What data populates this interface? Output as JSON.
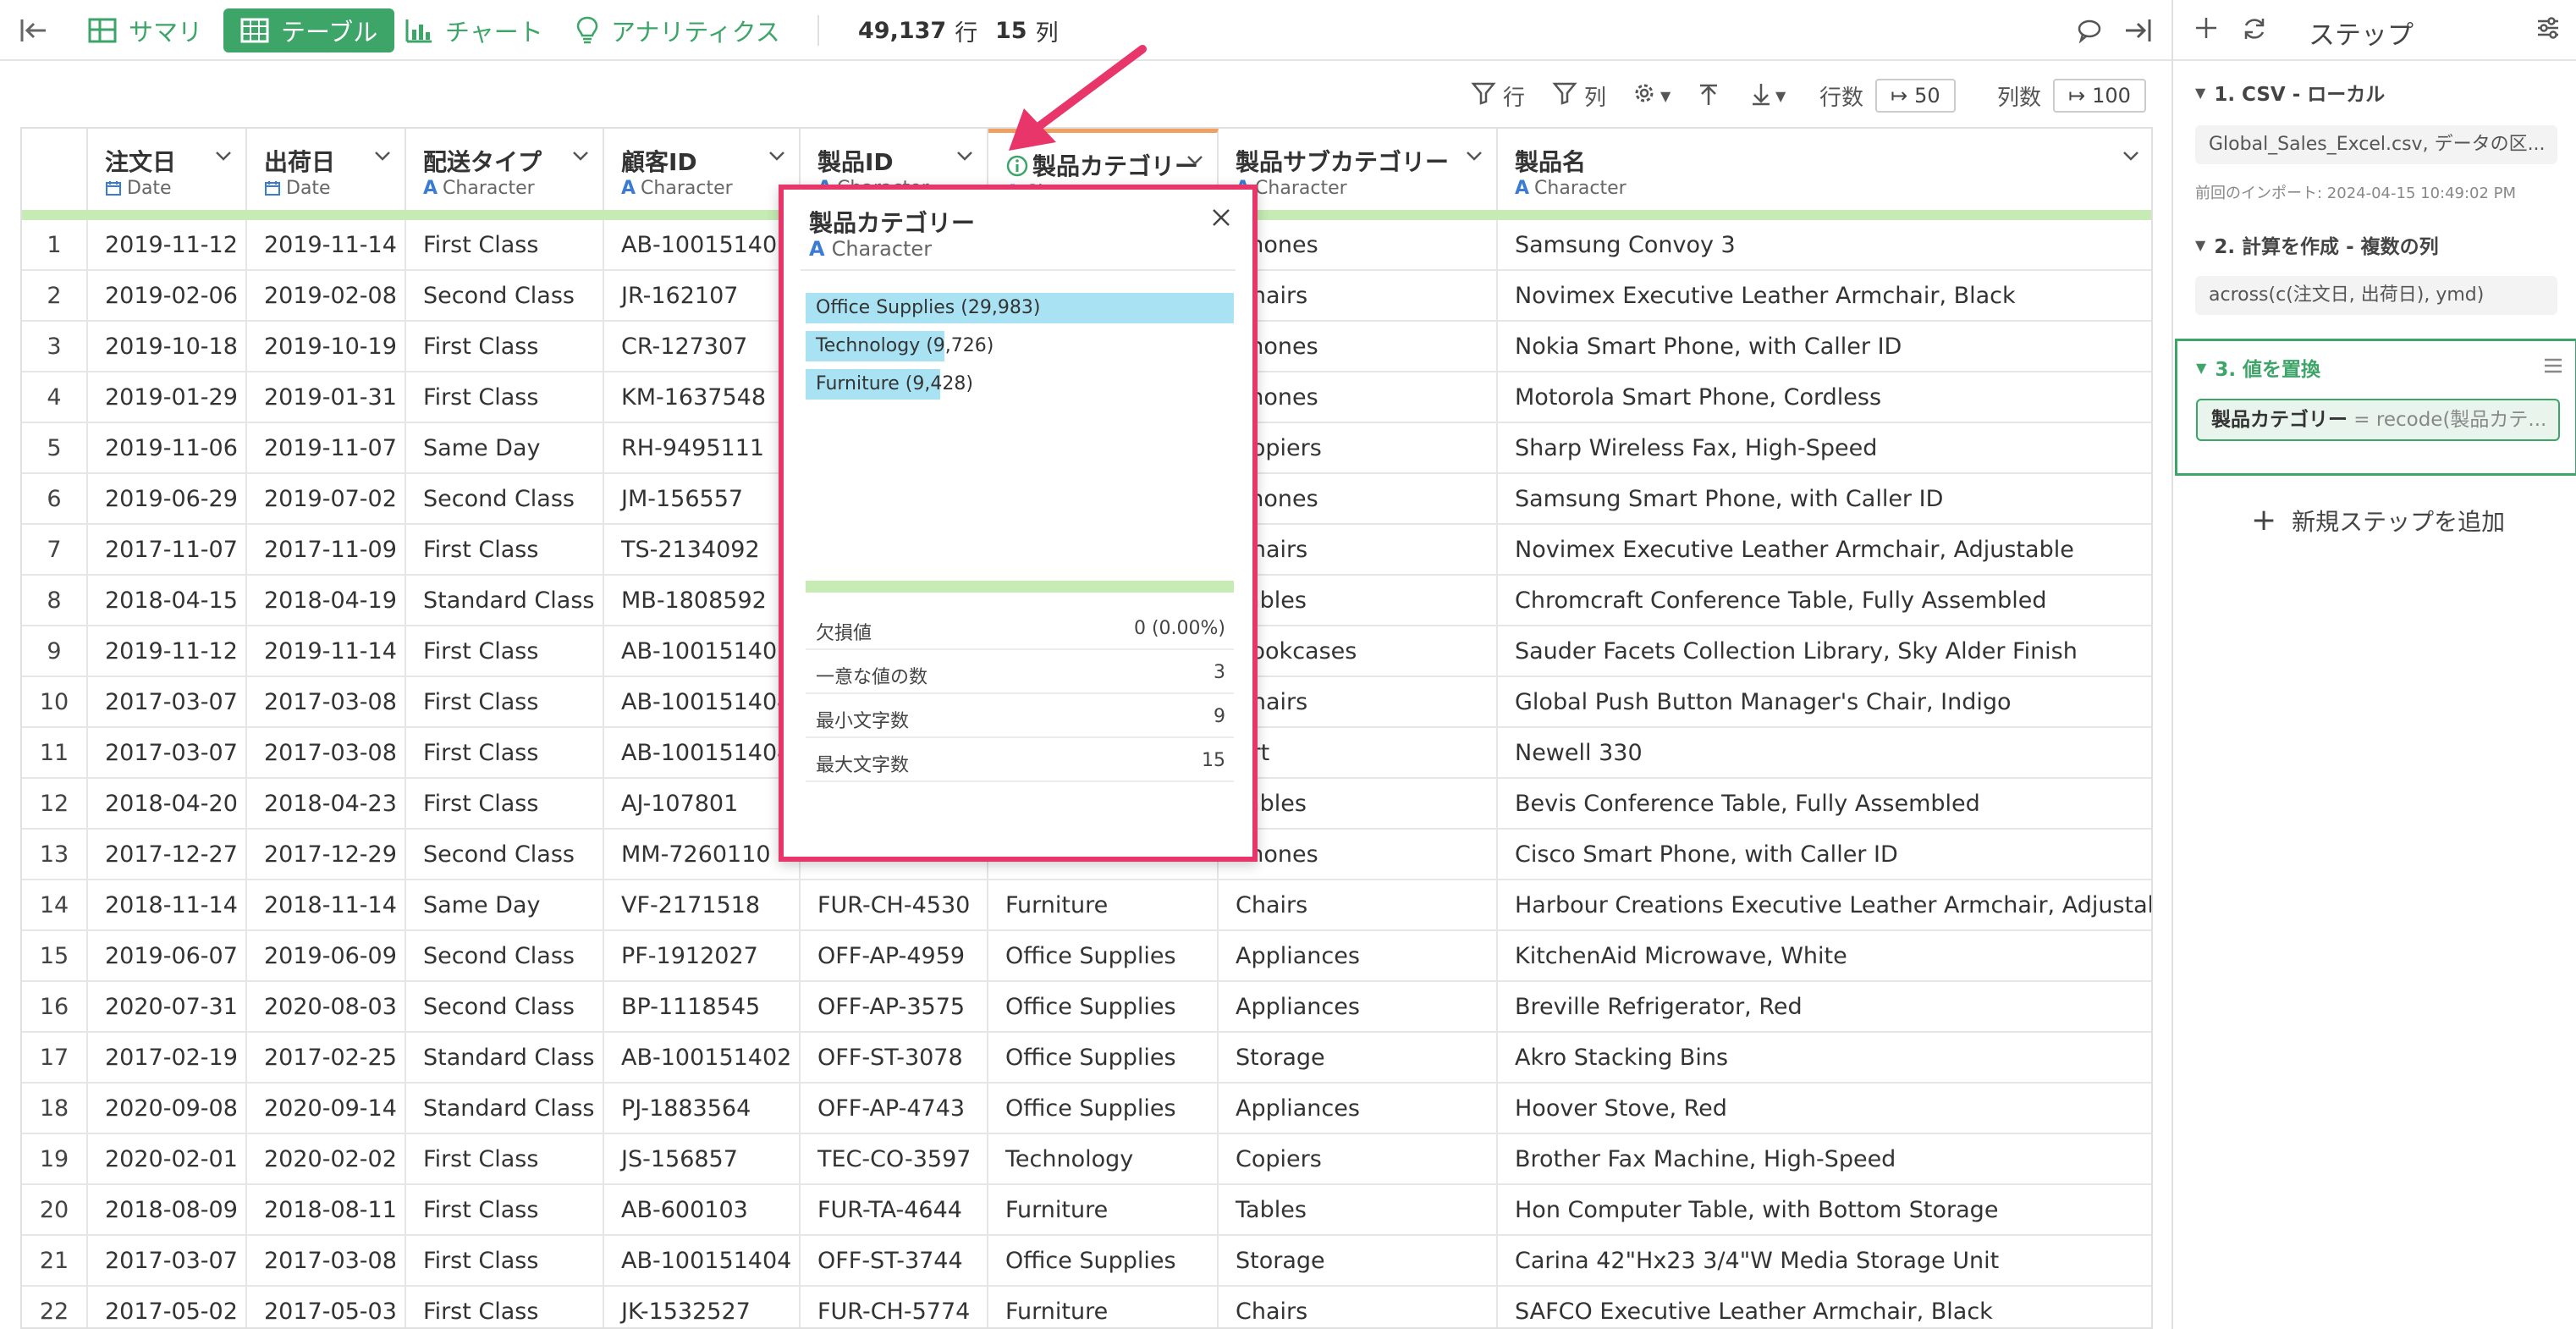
{
  "toolbar": {
    "tabs": [
      {
        "label": "サマリ",
        "icon": "summary-icon"
      },
      {
        "label": "テーブル",
        "icon": "table-icon"
      },
      {
        "label": "チャート",
        "icon": "chart-icon"
      },
      {
        "label": "アナリティクス",
        "icon": "lightbulb-icon"
      }
    ],
    "rows_count": "49,137",
    "rows_unit": "行",
    "cols_count": "15",
    "cols_unit": "列"
  },
  "toolbar2": {
    "row_filter": "行",
    "col_filter": "列",
    "rows_label": "行数",
    "rows_value": "50",
    "cols_label": "列数",
    "cols_value": "100"
  },
  "columns": [
    {
      "name": "注文日",
      "type": "Date",
      "icon": "calendar-icon"
    },
    {
      "name": "出荷日",
      "type": "Date",
      "icon": "calendar-icon"
    },
    {
      "name": "配送タイプ",
      "type": "Character",
      "icon": "character-icon"
    },
    {
      "name": "顧客ID",
      "type": "Character",
      "icon": "character-icon"
    },
    {
      "name": "製品ID",
      "type": "Character",
      "icon": "character-icon"
    },
    {
      "name": "製品カテゴリー",
      "type": "Character",
      "icon": "info-icon"
    },
    {
      "name": "製品サブカテゴリー",
      "type": "Character",
      "icon": "character-icon"
    },
    {
      "name": "製品名",
      "type": "Character",
      "icon": "character-icon"
    }
  ],
  "rows": [
    [
      "1",
      "2019-11-12",
      "2019-11-14",
      "First Class",
      "AB-100151402",
      "",
      "",
      "Phones",
      "Samsung Convoy 3"
    ],
    [
      "2",
      "2019-02-06",
      "2019-02-08",
      "Second Class",
      "JR-162107",
      "",
      "",
      "Chairs",
      "Novimex Executive Leather Armchair, Black"
    ],
    [
      "3",
      "2019-10-18",
      "2019-10-19",
      "First Class",
      "CR-127307",
      "",
      "",
      "Phones",
      "Nokia Smart Phone, with Caller ID"
    ],
    [
      "4",
      "2019-01-29",
      "2019-01-31",
      "First Class",
      "KM-1637548",
      "",
      "",
      "Phones",
      "Motorola Smart Phone, Cordless"
    ],
    [
      "5",
      "2019-11-06",
      "2019-11-07",
      "Same Day",
      "RH-9495111",
      "",
      "",
      "Copiers",
      "Sharp Wireless Fax, High-Speed"
    ],
    [
      "6",
      "2019-06-29",
      "2019-07-02",
      "Second Class",
      "JM-156557",
      "",
      "",
      "Phones",
      "Samsung Smart Phone, with Caller ID"
    ],
    [
      "7",
      "2017-11-07",
      "2017-11-09",
      "First Class",
      "TS-2134092",
      "",
      "",
      "Chairs",
      "Novimex Executive Leather Armchair, Adjustable"
    ],
    [
      "8",
      "2018-04-15",
      "2018-04-19",
      "Standard Class",
      "MB-1808592",
      "",
      "",
      "Tables",
      "Chromcraft Conference Table, Fully Assembled"
    ],
    [
      "9",
      "2019-11-12",
      "2019-11-14",
      "First Class",
      "AB-100151402",
      "",
      "",
      "Bookcases",
      "Sauder Facets Collection Library, Sky Alder Finish"
    ],
    [
      "10",
      "2017-03-07",
      "2017-03-08",
      "First Class",
      "AB-100151404",
      "",
      "",
      "Chairs",
      "Global Push Button Manager's Chair, Indigo"
    ],
    [
      "11",
      "2017-03-07",
      "2017-03-08",
      "First Class",
      "AB-100151404",
      "",
      "",
      "Art",
      "Newell 330"
    ],
    [
      "12",
      "2018-04-20",
      "2018-04-23",
      "First Class",
      "AJ-107801",
      "",
      "",
      "Tables",
      "Bevis Conference Table, Fully Assembled"
    ],
    [
      "13",
      "2017-12-27",
      "2017-12-29",
      "Second Class",
      "MM-7260110",
      "",
      "",
      "Phones",
      "Cisco Smart Phone, with Caller ID"
    ],
    [
      "14",
      "2018-11-14",
      "2018-11-14",
      "Same Day",
      "VF-2171518",
      "FUR-CH-4530",
      "Furniture",
      "Chairs",
      "Harbour Creations Executive Leather Armchair, Adjustable"
    ],
    [
      "15",
      "2019-06-07",
      "2019-06-09",
      "Second Class",
      "PF-1912027",
      "OFF-AP-4959",
      "Office Supplies",
      "Appliances",
      "KitchenAid Microwave, White"
    ],
    [
      "16",
      "2020-07-31",
      "2020-08-03",
      "Second Class",
      "BP-1118545",
      "OFF-AP-3575",
      "Office Supplies",
      "Appliances",
      "Breville Refrigerator, Red"
    ],
    [
      "17",
      "2017-02-19",
      "2017-02-25",
      "Standard Class",
      "AB-100151402",
      "OFF-ST-3078",
      "Office Supplies",
      "Storage",
      "Akro Stacking Bins"
    ],
    [
      "18",
      "2020-09-08",
      "2020-09-14",
      "Standard Class",
      "PJ-1883564",
      "OFF-AP-4743",
      "Office Supplies",
      "Appliances",
      "Hoover Stove, Red"
    ],
    [
      "19",
      "2020-02-01",
      "2020-02-02",
      "First Class",
      "JS-156857",
      "TEC-CO-3597",
      "Technology",
      "Copiers",
      "Brother Fax Machine, High-Speed"
    ],
    [
      "20",
      "2018-08-09",
      "2018-08-11",
      "First Class",
      "AB-600103",
      "FUR-TA-4644",
      "Furniture",
      "Tables",
      "Hon Computer Table, with Bottom Storage"
    ],
    [
      "21",
      "2017-03-07",
      "2017-03-08",
      "First Class",
      "AB-100151404",
      "OFF-ST-3744",
      "Office Supplies",
      "Storage",
      "Carina 42\"Hx23 3/4\"W Media Storage Unit"
    ],
    [
      "22",
      "2017-05-02",
      "2017-05-03",
      "First Class",
      "JK-1532527",
      "FUR-CH-5774",
      "Furniture",
      "Chairs",
      "SAFCO Executive Leather Armchair, Black"
    ]
  ],
  "popup": {
    "title": "製品カテゴリー",
    "type": "Character",
    "bars": [
      {
        "label": "Office Supplies (29,983)",
        "value": 29983
      },
      {
        "label": "Technology (9,726)",
        "value": 9726
      },
      {
        "label": "Furniture (9,428)",
        "value": 9428
      }
    ],
    "stats": [
      {
        "key": "欠損値",
        "value": "0 (0.00%)"
      },
      {
        "key": "一意な値の数",
        "value": "3"
      },
      {
        "key": "最小文字数",
        "value": "9"
      },
      {
        "key": "最大文字数",
        "value": "15"
      }
    ]
  },
  "steps_panel": {
    "title": "ステップ",
    "steps": [
      {
        "title": "1. CSV - ローカル",
        "detail": "Global_Sales_Excel.csv, データの区...",
        "note": "前回のインポート: 2024-04-15 10:49:02 PM"
      },
      {
        "title": "2. 計算を作成 - 複数の列",
        "detail": "across(c(注文日, 出荷日), ymd)"
      },
      {
        "title": "3. 値を置換",
        "chip_bold": "製品カテゴリー",
        "chip_rest": " = recode(製品カテ..."
      }
    ],
    "add_step": "新規ステップを追加"
  },
  "colors": {
    "accent": "#3ea569",
    "highlight": "#e8366b",
    "bar": "#a9e3f3",
    "quality_bar": "#c6ebb5"
  }
}
